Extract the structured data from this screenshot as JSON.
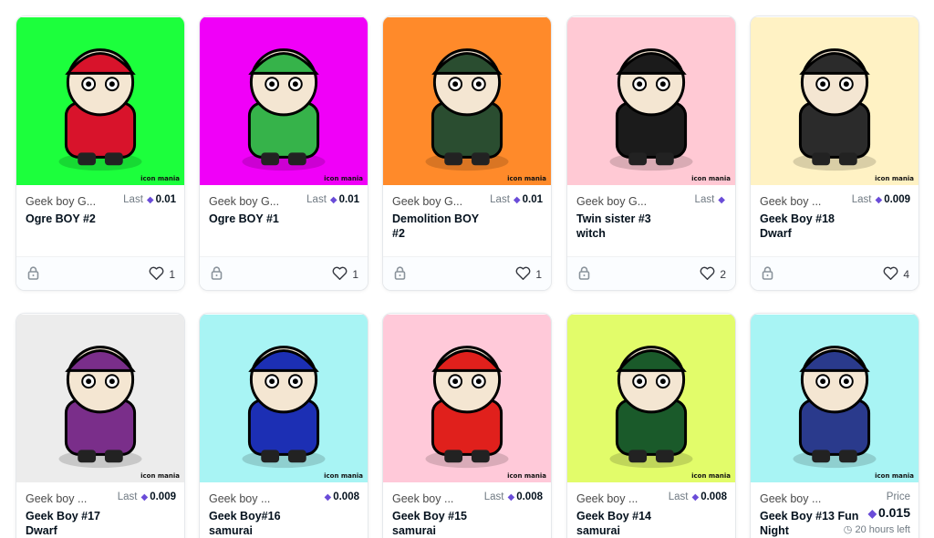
{
  "cards": [
    {
      "collection": "Geek boy G...",
      "title": "Ogre BOY #2",
      "price_label": "Last",
      "price": "0.01",
      "likes": "1",
      "bg": "#1cff3c",
      "accent": "#d8132b",
      "watermark": "icon mania"
    },
    {
      "collection": "Geek boy G...",
      "title": "Ogre BOY #1",
      "price_label": "Last",
      "price": "0.01",
      "likes": "1",
      "bg": "#f000f8",
      "accent": "#36b34a",
      "watermark": "icon mania"
    },
    {
      "collection": "Geek boy G...",
      "title": "Demolition BOY #2",
      "price_label": "Last",
      "price": "0.01",
      "likes": "1",
      "bg": "#ff8a2a",
      "accent": "#2a4d30",
      "watermark": "icon mania"
    },
    {
      "collection": "Geek boy G...",
      "title": "Twin sister #3 witch",
      "price_label": "Last",
      "price": "",
      "likes": "2",
      "bg": "#ffc9d4",
      "accent": "#1b1b1b",
      "watermark": "icon mania"
    },
    {
      "collection": "Geek boy ...",
      "title": "Geek Boy #18 Dwarf",
      "price_label": "Last",
      "price": "0.009",
      "likes": "4",
      "bg": "#fff2c4",
      "accent": "#2b2b2b",
      "watermark": "icon mania"
    },
    {
      "collection": "Geek boy ...",
      "title": "Geek Boy #17 Dwarf",
      "price_label": "Last",
      "price": "0.009",
      "likes": "",
      "bg": "#ececec",
      "accent": "#7a2e8a",
      "watermark": "icon mania"
    },
    {
      "collection": "Geek boy ...",
      "title": "Geek Boy#16 samurai",
      "price_label": "",
      "price": "0.008",
      "likes": "",
      "bg": "#a8f4f4",
      "accent": "#1c2fb4",
      "watermark": "icon mania"
    },
    {
      "collection": "Geek boy ...",
      "title": "Geek Boy #15 samurai",
      "price_label": "Last",
      "price": "0.008",
      "likes": "",
      "bg": "#ffc9d9",
      "accent": "#e0201c",
      "watermark": "icon mania"
    },
    {
      "collection": "Geek boy ...",
      "title": "Geek Boy #14 samurai",
      "price_label": "Last",
      "price": "0.008",
      "likes": "",
      "bg": "#e2fc6a",
      "accent": "#1a5a2a",
      "watermark": "icon mania"
    },
    {
      "collection": "Geek boy ...",
      "title": "Geek Boy #13 Fun Night",
      "price_label": "Price",
      "price": "0.015",
      "time_left": "20 hours left",
      "likes": "",
      "bg": "#a8f4f4",
      "accent": "#2a3a8c",
      "watermark": "icon mania"
    }
  ],
  "icons": {
    "lock": "lock-icon",
    "heart": "heart-icon",
    "eth": "eth-icon",
    "clock": "clock-icon"
  }
}
